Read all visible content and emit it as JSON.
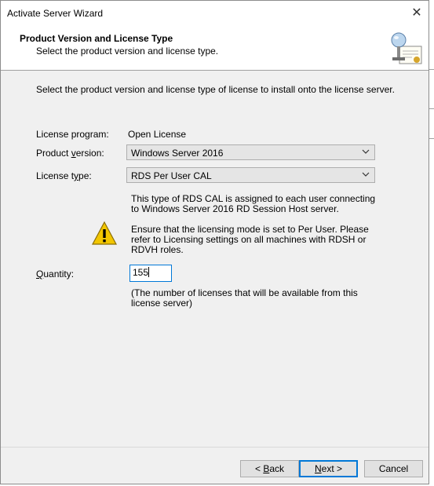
{
  "window": {
    "title": "Activate Server Wizard"
  },
  "header": {
    "title": "Product Version and License Type",
    "subtitle": "Select the product version and license type.",
    "icon": "certificate-server-icon"
  },
  "main": {
    "instruction": "Select the product version and license type of license to install onto the license server.",
    "license_program": {
      "label": "License program:",
      "value": "Open License"
    },
    "product_version": {
      "label_pre": "Product ",
      "label_key": "v",
      "label_post": "ersion:",
      "selected": "Windows Server 2016"
    },
    "license_type": {
      "label_pre": "License t",
      "label_key": "y",
      "label_post": "pe:",
      "selected": "RDS Per User CAL"
    },
    "description": "This type of RDS CAL is assigned to each user connecting to Windows Server 2016 RD Session Host server.",
    "warning": "Ensure that the licensing mode is set to Per User. Please refer to Licensing settings on all machines with RDSH or RDVH roles.",
    "quantity": {
      "label_key": "Q",
      "label_post": "uantity:",
      "value": "155"
    },
    "quantity_note": "(The number of licenses that will be available from this license server)"
  },
  "footer": {
    "back": {
      "pre": "< ",
      "key": "B",
      "post": "ack"
    },
    "next": {
      "key": "N",
      "post": "ext >"
    },
    "cancel": "Cancel"
  },
  "colors": {
    "accent": "#0078d7",
    "dialog_bg": "#f0f0f0",
    "warning": "#f2c600"
  }
}
